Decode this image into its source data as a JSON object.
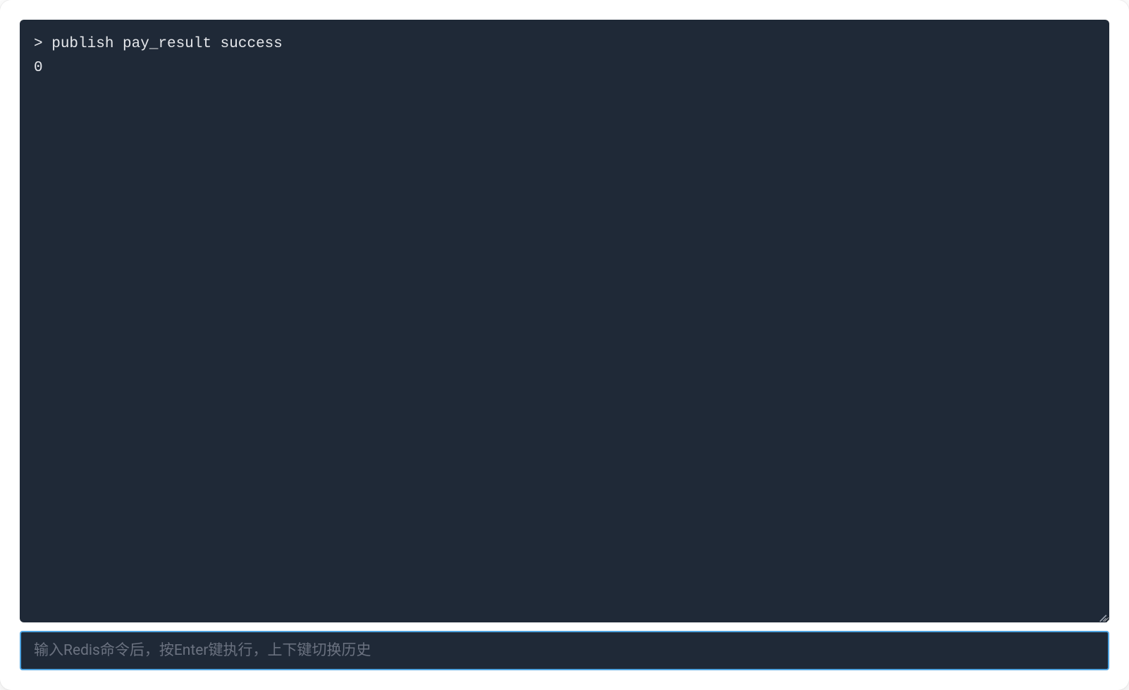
{
  "terminal": {
    "prompt": ">",
    "command": "publish pay_result success",
    "result": "0"
  },
  "input": {
    "placeholder": "输入Redis命令后，按Enter键执行，上下键切换历史",
    "value": ""
  },
  "colors": {
    "terminal_bg": "#1f2937",
    "terminal_text": "#e5e7eb",
    "input_border_focus": "#4fa3e0",
    "placeholder": "#6b7280"
  }
}
